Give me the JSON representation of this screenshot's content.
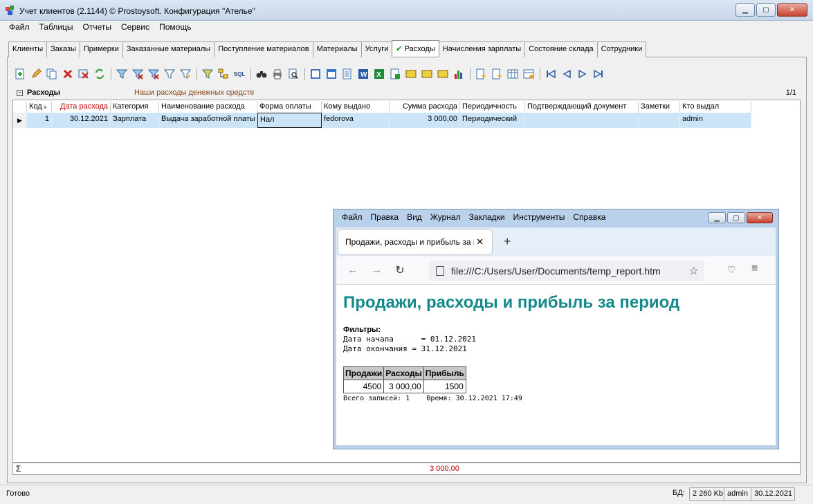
{
  "window": {
    "title": "Учет клиентов (2.1144) © Prostoysoft. Конфигурация \"Ателье\""
  },
  "menu": [
    "Файл",
    "Таблицы",
    "Отчеты",
    "Сервис",
    "Помощь"
  ],
  "tabs": [
    "Клиенты",
    "Заказы",
    "Примерки",
    "Заказанные материалы",
    "Поступление материалов",
    "Материалы",
    "Услуги",
    "Расходы",
    "Начисления зарплаты",
    "Состояние склада",
    "Сотрудники"
  ],
  "active_tab": "Расходы",
  "grid": {
    "title": "Расходы",
    "subtitle": "Наши расходы денежных средств",
    "page": "1/1",
    "columns": [
      "Код",
      "Дата расхода",
      "Категория",
      "Наименование расхода",
      "Форма оплаты",
      "Кому выдано",
      "Сумма расхода",
      "Периодичность",
      "Подтверждающий документ",
      "Заметки",
      "Кто выдал"
    ],
    "rows": [
      {
        "code": "1",
        "date": "30.12.2021",
        "category": "Зарплата",
        "name": "Выдача заработной платы",
        "payment": "Нал",
        "recipient": "fedorova",
        "amount": "3 000,00",
        "periodicity": "Периодический",
        "document": "",
        "notes": "",
        "issued_by": "admin"
      }
    ],
    "sum": "3 000,00"
  },
  "status": {
    "ready": "Готово",
    "db_label": "БД:",
    "db_size": "2 260 Kb",
    "user": "admin",
    "date": "30.12.2021"
  },
  "browser": {
    "menu": [
      "Файл",
      "Правка",
      "Вид",
      "Журнал",
      "Закладки",
      "Инструменты",
      "Справка"
    ],
    "tab_title": "Продажи, расходы и прибыль за п",
    "url": "file:///C:/Users/User/Documents/temp_report.htm",
    "report": {
      "heading": "Продажи, расходы и прибыль за период",
      "filters_label": "Фильтры:",
      "start_line": "Дата начала      = 01.12.2021",
      "end_line": "Дата окончания = 31.12.2021",
      "headers": [
        "Продажи",
        "Расходы",
        "Прибыль"
      ],
      "values": [
        "4500",
        "3 000,00",
        "1500"
      ],
      "footer": "Всего записей: 1    Время: 30.12.2021 17:49"
    }
  }
}
